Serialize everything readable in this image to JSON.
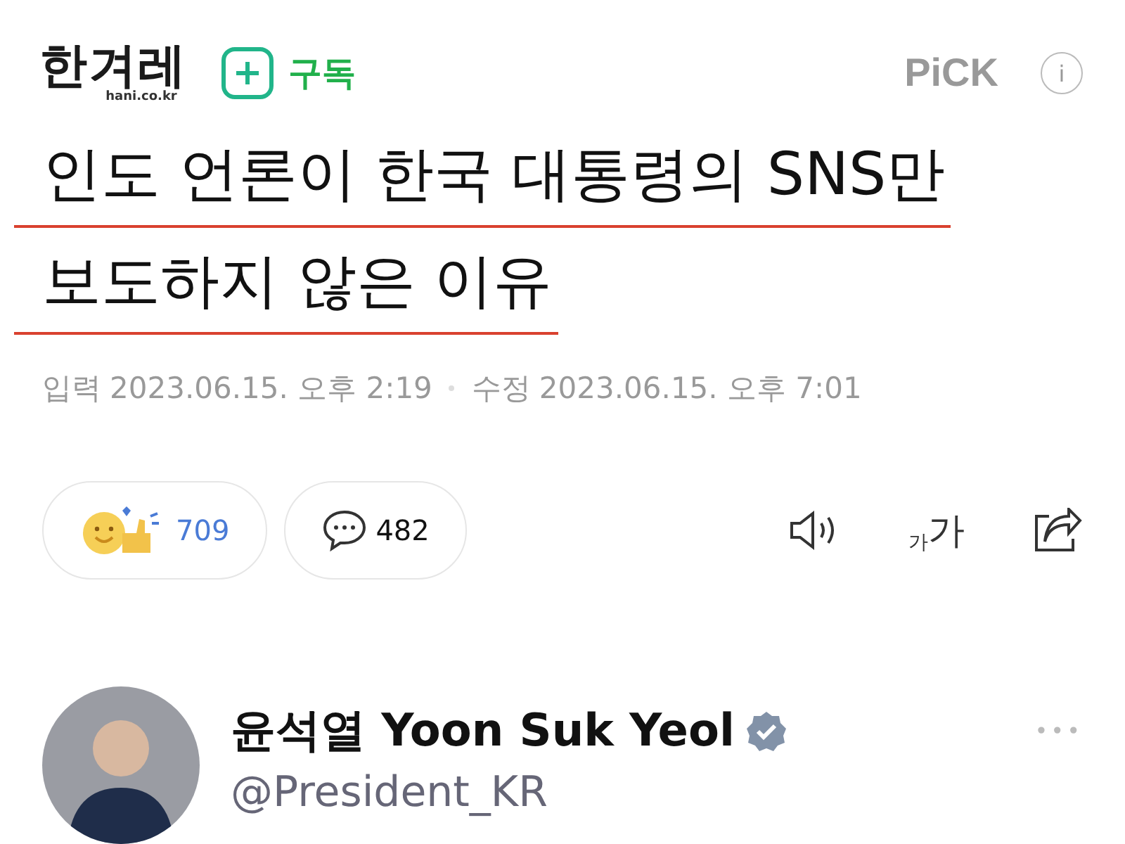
{
  "header": {
    "logo": "한겨레",
    "logo_sub": "hani.co.kr",
    "subscribe": "구독",
    "pick": "PiCK",
    "info": "i"
  },
  "headline": [
    "인도 언론이 한국 대통령의 SNS만",
    "보도하지 않은 이유"
  ],
  "meta": {
    "input_label": "입력",
    "input_time": "2023.06.15. 오후 2:19",
    "edit_label": "수정",
    "edit_time": "2023.06.15. 오후 7:01"
  },
  "actions": {
    "reactions": "709",
    "comments": "482",
    "font_size_small": "가",
    "font_size_large": "가"
  },
  "tweet": {
    "name": "윤석열 Yoon Suk Yeol",
    "verified": true,
    "handle": "@President_KR",
    "more": "•••"
  }
}
